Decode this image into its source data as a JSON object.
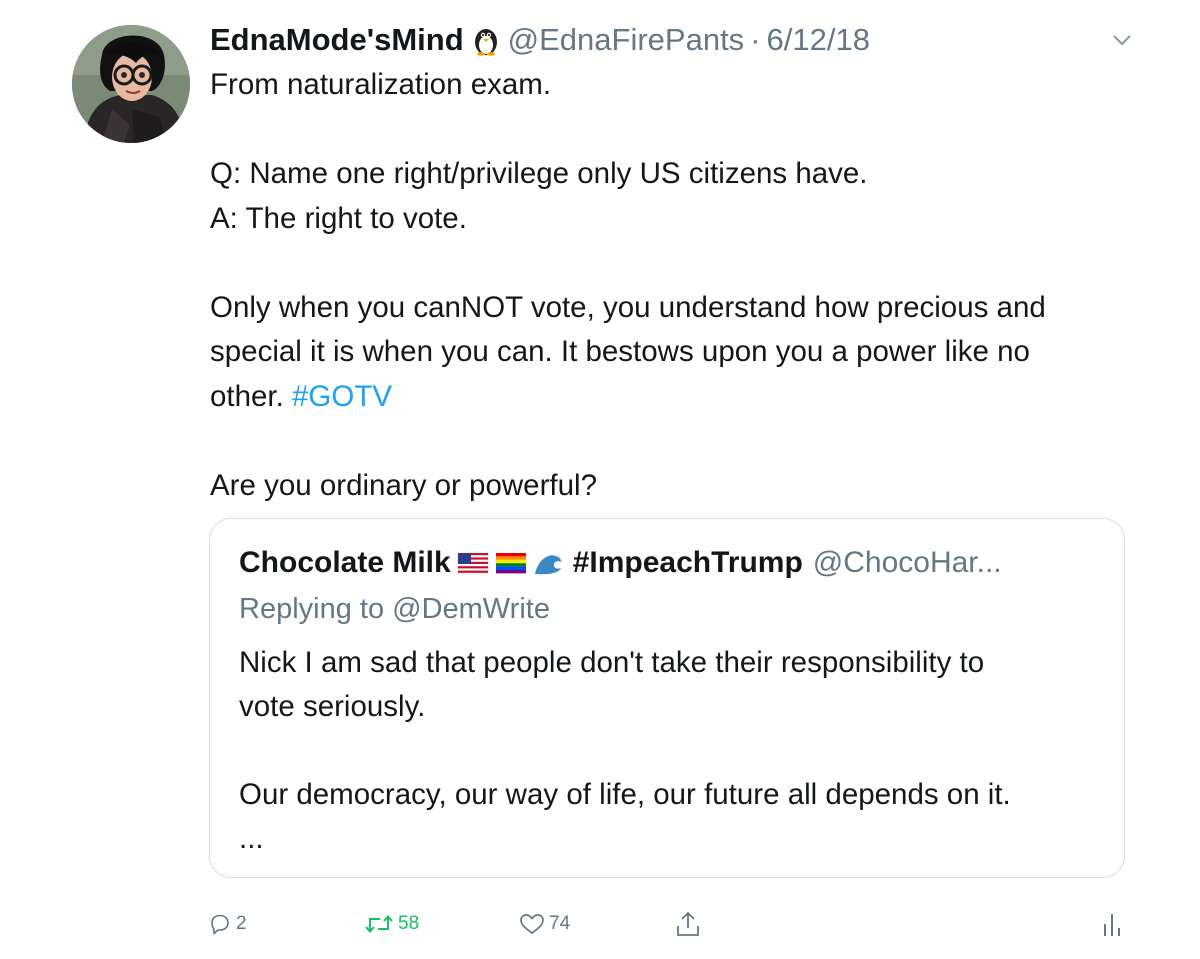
{
  "tweet": {
    "display_name": "EdnaMode'sMind",
    "handle": "@EdnaFirePants",
    "separator": "·",
    "date": "6/12/18",
    "body_line1": "From naturalization exam.",
    "body_q": "Q: Name one right/privilege only US citizens have.",
    "body_a": "A: The right to vote.",
    "body_para_line1": "Only when you canNOT vote, you understand how precious and",
    "body_para_line2": "special it is when you can. It bestows upon you a power like no",
    "body_para_line3_prefix": "other. ",
    "hashtag": "#GOTV",
    "body_closing": "Are you ordinary or powerful?"
  },
  "quoted_tweet": {
    "display_name": "Chocolate Milk",
    "hashtag_name": "#ImpeachTrump",
    "handle": "@ChocoHar...",
    "replying_to": "Replying to @DemWrite",
    "body_line1": "Nick I am sad that people don't take their responsibility to",
    "body_line2": "vote seriously.",
    "body_line3": "Our democracy,  our way of life, our future all depends on it.",
    "body_ellipsis": "..."
  },
  "actions": {
    "reply_count": "2",
    "retweet_count": "58",
    "like_count": "74",
    "retweet_color": "#17bf63"
  },
  "colors": {
    "text": "#14171a",
    "secondary": "#657786",
    "link": "#1da1f2",
    "border": "#d7dde2"
  },
  "icons": {
    "menu": "chevron-down-icon",
    "reply": "reply-icon",
    "retweet": "retweet-icon",
    "like": "heart-icon",
    "share": "share-icon",
    "analytics": "analytics-icon",
    "name_emoji": "penguin-icon",
    "quote_emojis": [
      "us-flag-icon",
      "rainbow-flag-icon",
      "wave-icon"
    ]
  }
}
